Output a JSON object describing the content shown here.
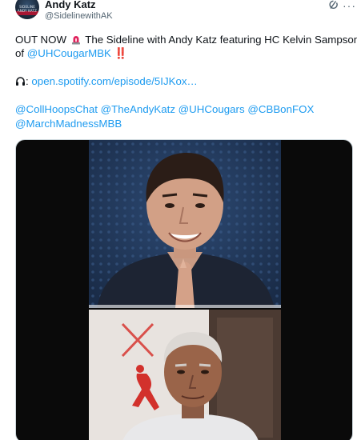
{
  "author": {
    "name": "Andy Katz",
    "handle": "@SidelinewithAK",
    "avatar_text": "SIDELINE ANDY KATZ"
  },
  "tweet": {
    "line1_text": "OUT NOW",
    "line1_rest": "The Sideline with Andy Katz featuring HC Kelvin Sampson",
    "line2_prefix": "of",
    "line2_mention": "@UHCougarMBK",
    "line2_bang": "‼️",
    "spotify_colon": ":",
    "spotify_link": "open.spotify.com/episode/5IJKox…",
    "mentions_line1": [
      "@CollHoopsChat",
      "@TheAndyKatz",
      "@UHCougars",
      "@CBBonFOX"
    ],
    "mentions_line2": [
      "@MarchMadnessMBB"
    ]
  },
  "colors": {
    "link": "#1d9bf0",
    "text": "#0f1419",
    "secondary": "#536471",
    "siren": "#e0245e"
  },
  "icons": {
    "grok": "grok-icon",
    "more": "more-icon",
    "siren": "rotating-light-icon",
    "headphones": "headphones-icon"
  }
}
